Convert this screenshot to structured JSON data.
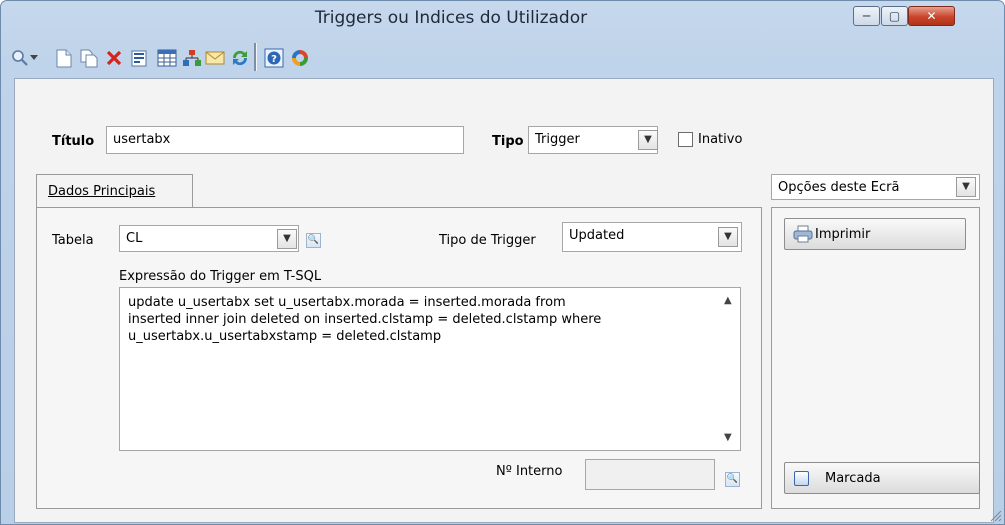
{
  "window": {
    "title": "Triggers ou Indices do Utilizador",
    "controls": [
      "─",
      "▢",
      "✕"
    ]
  },
  "toolbar": {
    "icons": [
      "search-icon",
      "dropdown-arrow-icon",
      "new-document-icon",
      "copy-document-icon",
      "delete-icon",
      "properties-icon",
      "grid-icon",
      "network-icon",
      "email-icon",
      "refresh-icon",
      "help-icon",
      "sync-icon"
    ]
  },
  "form": {
    "titulo_label": "Título",
    "titulo_value": "usertabx",
    "tipo_label": "Tipo",
    "tipo_value": "Trigger",
    "inativo_label": "Inativo",
    "inativo_checked": false
  },
  "tabs": [
    {
      "label": "Dados Principais",
      "active": true
    }
  ],
  "main": {
    "tabela_label": "Tabela",
    "tabela_value": "CL",
    "tipo_trigger_label": "Tipo de Trigger",
    "tipo_trigger_value": "Updated",
    "expressao_label": "Expressão do Trigger em T-SQL",
    "expressao_lines": [
      "update u_usertabx set u_usertabx.morada = inserted.morada from",
      "inserted inner join deleted on inserted.clstamp = deleted.clstamp where",
      "u_usertabx.u_usertabxstamp = deleted.clstamp"
    ],
    "n_interno_label": "Nº Interno",
    "n_interno_value": ""
  },
  "side": {
    "options_value": "Opções deste Ecrã",
    "imprimir_label": "Imprimir",
    "marcada_label": "Marcada"
  },
  "colors": {
    "title_bg": "#c6d8ec",
    "close_button": "#c9452c",
    "client_bg": "#f3f3f3"
  }
}
